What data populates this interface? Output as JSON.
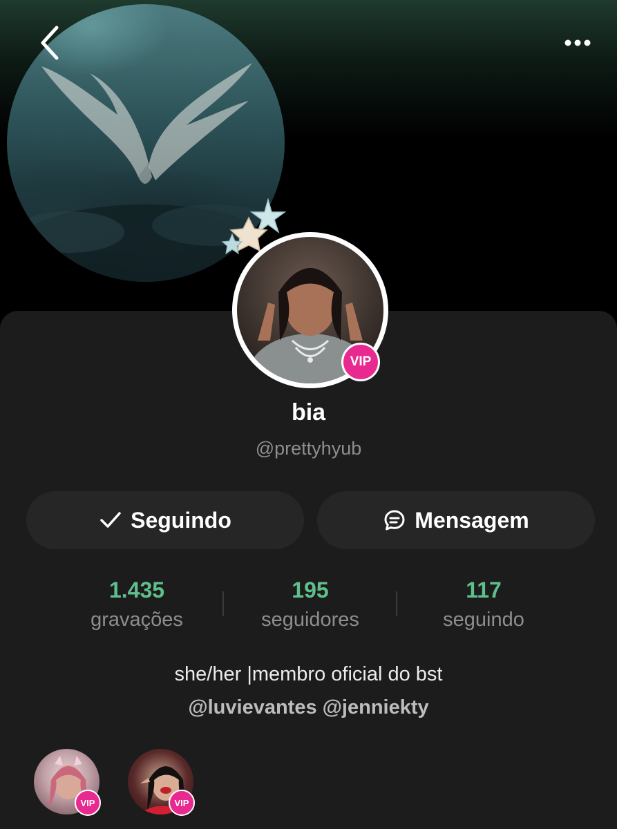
{
  "header": {
    "back_icon": "chevron-left-icon",
    "more_icon": "more-horizontal-icon"
  },
  "profile": {
    "display_name": "bia",
    "handle": "@prettyhyub",
    "badge": "VIP"
  },
  "actions": {
    "follow_label": "Seguindo",
    "follow_icon": "check-icon",
    "message_label": "Mensagem",
    "message_icon": "chat-bubble-icon"
  },
  "stats": [
    {
      "value": "1.435",
      "label": "gravações"
    },
    {
      "value": "195",
      "label": "seguidores"
    },
    {
      "value": "117",
      "label": "seguindo"
    }
  ],
  "bio": {
    "line1": "she/her |membro oficial do bst",
    "mentions": [
      "@luvievantes",
      "@jenniekty"
    ]
  },
  "friends": [
    {
      "badge": "VIP"
    },
    {
      "badge": "VIP"
    }
  ],
  "colors": {
    "accent_green": "#5fc08d",
    "vip_pink": "#e8298f",
    "panel_bg": "#1c1c1c",
    "button_bg": "#262626"
  }
}
